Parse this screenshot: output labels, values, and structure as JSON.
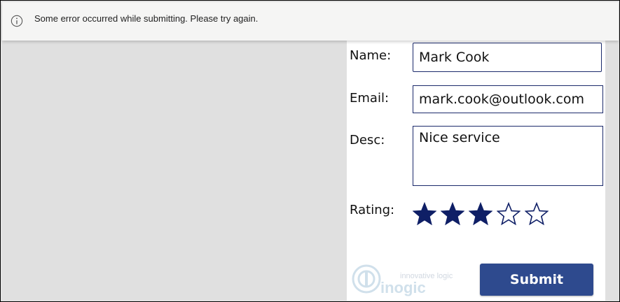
{
  "notification": {
    "message": "Some error occurred while submitting. Please try again.",
    "icon": "info-icon"
  },
  "form": {
    "name_label": "Name:",
    "name_value": "Mark Cook",
    "email_label": "Email:",
    "email_value": "mark.cook@outlook.com",
    "desc_label": "Desc:",
    "desc_value": "Nice service",
    "rating_label": "Rating:",
    "rating": {
      "value": 3,
      "max": 5
    },
    "submit_label": "Submit"
  },
  "logo": {
    "tagline": "innovative logic",
    "brand": "inogic"
  },
  "colors": {
    "accent": "#1b2a6b",
    "button": "#2e4a8e",
    "star_fill": "#0f1f66",
    "background": "#e0e0e0",
    "notification_bg": "#f5f5f4"
  }
}
